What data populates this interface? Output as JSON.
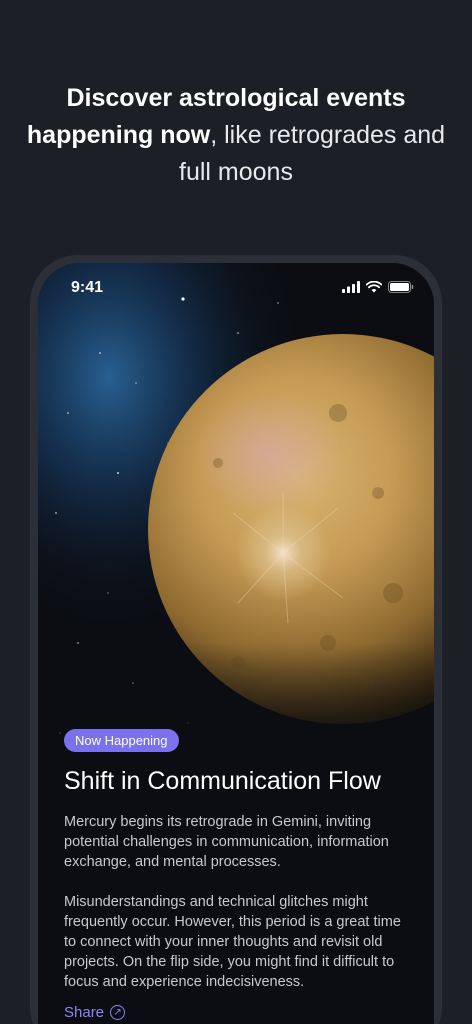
{
  "headline": {
    "bold": "Discover astrological events happening now",
    "rest": ", like retrogrades and full moons"
  },
  "status_bar": {
    "time": "9:41",
    "icons": [
      "cellular-signal-icon",
      "wifi-icon",
      "battery-icon"
    ]
  },
  "event": {
    "badge": "Now Happening",
    "title": "Shift in Communication Flow",
    "paragraph_1": "Mercury begins its retrograde in Gemini, inviting potential challenges in communication, information exchange, and mental processes.",
    "paragraph_2": "Misunderstandings and technical glitches might frequently occur. However, this period is a great time to connect with your inner thoughts and revisit old projects. On the flip side, you might find it difficult to focus and experience indecisiveness.",
    "share_label": "Share",
    "share_icon": "arrow-up-right-circle-icon"
  },
  "colors": {
    "background": "#1c1f25",
    "accent": "#7a72ec",
    "link": "#8d86f5"
  }
}
